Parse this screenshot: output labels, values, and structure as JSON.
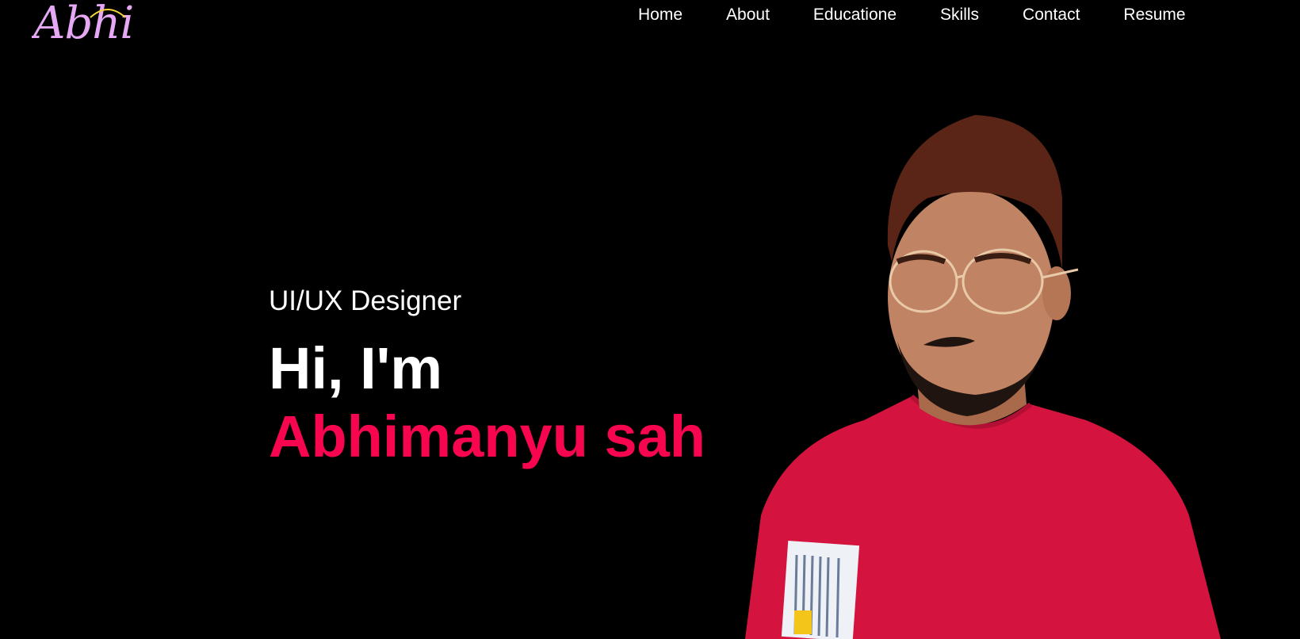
{
  "brand": {
    "logo_text": "Abhi"
  },
  "nav": {
    "items": [
      {
        "label": "Home"
      },
      {
        "label": "About"
      },
      {
        "label": "Educatione"
      },
      {
        "label": "Skills"
      },
      {
        "label": "Contact"
      },
      {
        "label": "Resume"
      }
    ]
  },
  "hero": {
    "role": "UI/UX Designer",
    "greeting": "Hi, I'm",
    "name": "Abhimanyu sah"
  },
  "colors": {
    "background": "#000000",
    "text": "#ffffff",
    "accent": "#f7064f",
    "logo": "#e6a8f5",
    "shirt": "#d4143e"
  }
}
